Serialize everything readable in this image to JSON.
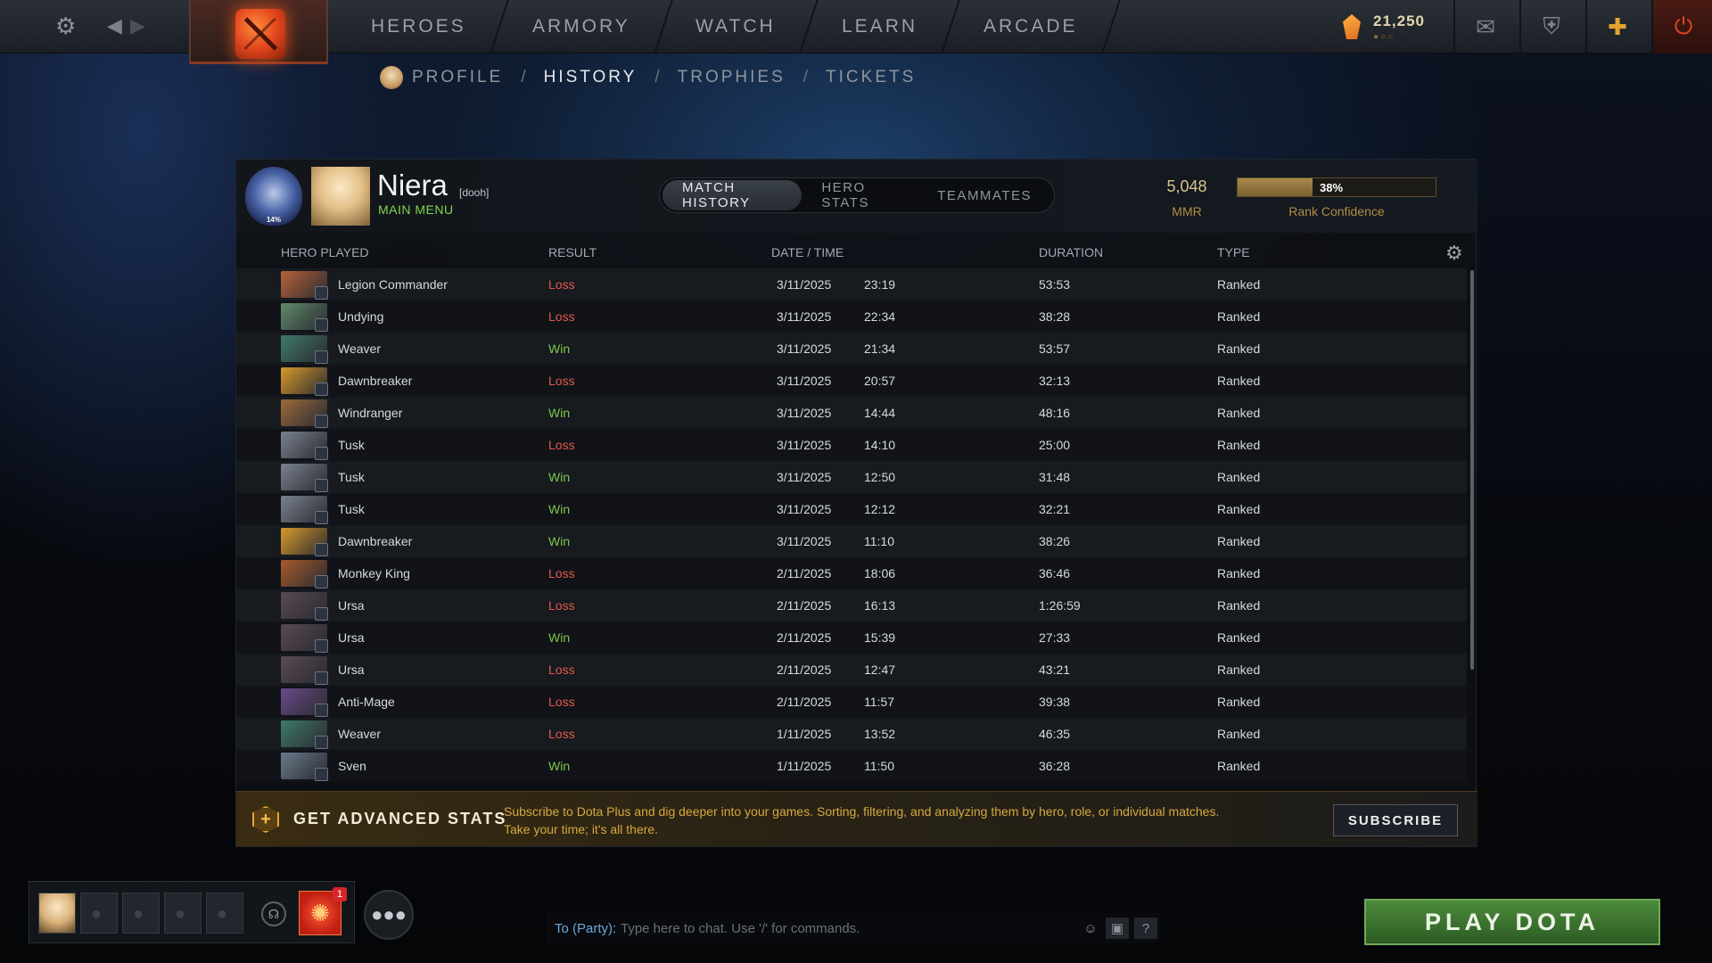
{
  "topbar": {
    "nav": [
      "HEROES",
      "ARMORY",
      "WATCH",
      "LEARN",
      "ARCADE"
    ],
    "shards": "21,250",
    "shard_dots": "●○○"
  },
  "subnav": {
    "items": [
      "PROFILE",
      "HISTORY",
      "TROPHIES",
      "TICKETS"
    ],
    "separator": "/",
    "active": "HISTORY"
  },
  "profile": {
    "rank_percent": "14%",
    "name": "Niera",
    "tag": "[dooh]",
    "status": "MAIN MENU",
    "tabs": [
      "MATCH HISTORY",
      "HERO STATS",
      "TEAMMATES"
    ],
    "active_tab": "MATCH HISTORY",
    "mmr_value": "5,048",
    "mmr_label": "MMR",
    "confidence_value": 0.38,
    "confidence_text": "38%",
    "confidence_label": "Rank Confidence"
  },
  "table": {
    "headers": {
      "hero": "HERO PLAYED",
      "result": "RESULT",
      "datetime": "DATE / TIME",
      "duration": "DURATION",
      "type": "TYPE"
    },
    "rows": [
      {
        "hero": "Legion Commander",
        "result": "Loss",
        "date": "3/11/2025",
        "time": "23:19",
        "duration": "53:53",
        "type": "Ranked",
        "color": "#b8643a"
      },
      {
        "hero": "Undying",
        "result": "Loss",
        "date": "3/11/2025",
        "time": "22:34",
        "duration": "38:28",
        "type": "Ranked",
        "color": "#5f8a6a"
      },
      {
        "hero": "Weaver",
        "result": "Win",
        "date": "3/11/2025",
        "time": "21:34",
        "duration": "53:57",
        "type": "Ranked",
        "color": "#3f7a6a"
      },
      {
        "hero": "Dawnbreaker",
        "result": "Loss",
        "date": "3/11/2025",
        "time": "20:57",
        "duration": "32:13",
        "type": "Ranked",
        "color": "#d89a2a"
      },
      {
        "hero": "Windranger",
        "result": "Win",
        "date": "3/11/2025",
        "time": "14:44",
        "duration": "48:16",
        "type": "Ranked",
        "color": "#9a6a3a"
      },
      {
        "hero": "Tusk",
        "result": "Loss",
        "date": "3/11/2025",
        "time": "14:10",
        "duration": "25:00",
        "type": "Ranked",
        "color": "#7a8290"
      },
      {
        "hero": "Tusk",
        "result": "Win",
        "date": "3/11/2025",
        "time": "12:50",
        "duration": "31:48",
        "type": "Ranked",
        "color": "#7a8290"
      },
      {
        "hero": "Tusk",
        "result": "Win",
        "date": "3/11/2025",
        "time": "12:12",
        "duration": "32:21",
        "type": "Ranked",
        "color": "#7a8290"
      },
      {
        "hero": "Dawnbreaker",
        "result": "Win",
        "date": "3/11/2025",
        "time": "11:10",
        "duration": "38:26",
        "type": "Ranked",
        "color": "#d89a2a"
      },
      {
        "hero": "Monkey King",
        "result": "Loss",
        "date": "2/11/2025",
        "time": "18:06",
        "duration": "36:46",
        "type": "Ranked",
        "color": "#a85a2a"
      },
      {
        "hero": "Ursa",
        "result": "Loss",
        "date": "2/11/2025",
        "time": "16:13",
        "duration": "1:26:59",
        "type": "Ranked",
        "color": "#5a4a52"
      },
      {
        "hero": "Ursa",
        "result": "Win",
        "date": "2/11/2025",
        "time": "15:39",
        "duration": "27:33",
        "type": "Ranked",
        "color": "#5a4a52"
      },
      {
        "hero": "Ursa",
        "result": "Loss",
        "date": "2/11/2025",
        "time": "12:47",
        "duration": "43:21",
        "type": "Ranked",
        "color": "#5a4a52"
      },
      {
        "hero": "Anti-Mage",
        "result": "Loss",
        "date": "2/11/2025",
        "time": "11:57",
        "duration": "39:38",
        "type": "Ranked",
        "color": "#6a4a8a"
      },
      {
        "hero": "Weaver",
        "result": "Loss",
        "date": "1/11/2025",
        "time": "13:52",
        "duration": "46:35",
        "type": "Ranked",
        "color": "#3f7a6a"
      },
      {
        "hero": "Sven",
        "result": "Win",
        "date": "1/11/2025",
        "time": "11:50",
        "duration": "36:28",
        "type": "Ranked",
        "color": "#6a7a8a"
      }
    ]
  },
  "promo": {
    "icon": "+",
    "title": "GET ADVANCED STATS",
    "text": "Subscribe to Dota Plus and dig deeper into your games. Sorting, filtering, and analyzing them by hero, role, or individual matches. Take your time; it's all there.",
    "button": "SUBSCRIBE"
  },
  "bottom": {
    "event_badge": "1",
    "chat_to": "To (Party):",
    "chat_placeholder": "Type here to chat. Use '/' for commands.",
    "chat_help": "?",
    "play_button": "PLAY DOTA"
  },
  "colors": {
    "loss": "#e05a4a",
    "win": "#7ac94a",
    "gold": "#d7a93e",
    "play": "#4d8a3c"
  }
}
